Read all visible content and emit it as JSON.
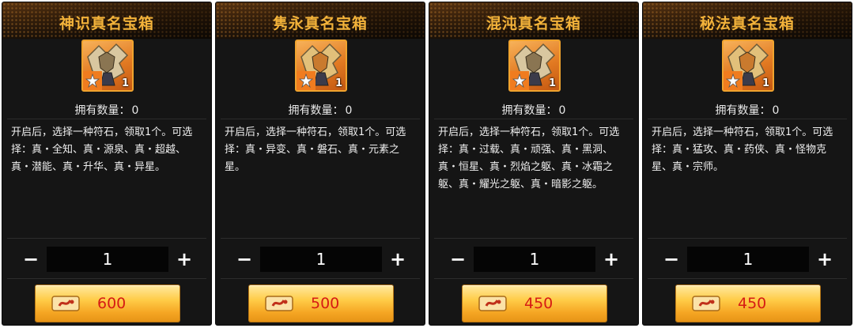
{
  "owned_label": "拥有数量：",
  "accent_color": "#f2b23a",
  "price_color": "#d61b14",
  "currency_icon": "ticket-icon",
  "chests": [
    {
      "title": "神识真名宝箱",
      "item_icon": "chest-armor-icon",
      "item_count": "1",
      "owned_count": "0",
      "description": "开启后，选择一种符石，领取1个。可选择：真・全知、真・源泉、真・超越、真・潜能、真・升华、真・异星。",
      "quantity": "1",
      "minus_label": "−",
      "plus_label": "+",
      "price": "600"
    },
    {
      "title": "隽永真名宝箱",
      "item_icon": "chest-armor-icon",
      "item_count": "1",
      "owned_count": "0",
      "description": "开启后，选择一种符石，领取1个。可选择：真・异变、真・磐石、真・元素之星。",
      "quantity": "1",
      "minus_label": "−",
      "plus_label": "+",
      "price": "500"
    },
    {
      "title": "混沌真名宝箱",
      "item_icon": "chest-armor-icon",
      "item_count": "1",
      "owned_count": "0",
      "description": "开启后，选择一种符石，领取1个。可选择：真・过载、真・顽强、真・黑洞、真・恒星、真・烈焰之躯、真・冰霜之躯、真・耀光之躯、真・暗影之躯。",
      "quantity": "1",
      "minus_label": "−",
      "plus_label": "+",
      "price": "450"
    },
    {
      "title": "秘法真名宝箱",
      "item_icon": "chest-armor-icon",
      "item_count": "1",
      "owned_count": "0",
      "description": "开启后，选择一种符石，领取1个。可选择：真・猛攻、真・药侠、真・怪物克星、真・宗师。",
      "quantity": "1",
      "minus_label": "−",
      "plus_label": "+",
      "price": "450"
    }
  ]
}
